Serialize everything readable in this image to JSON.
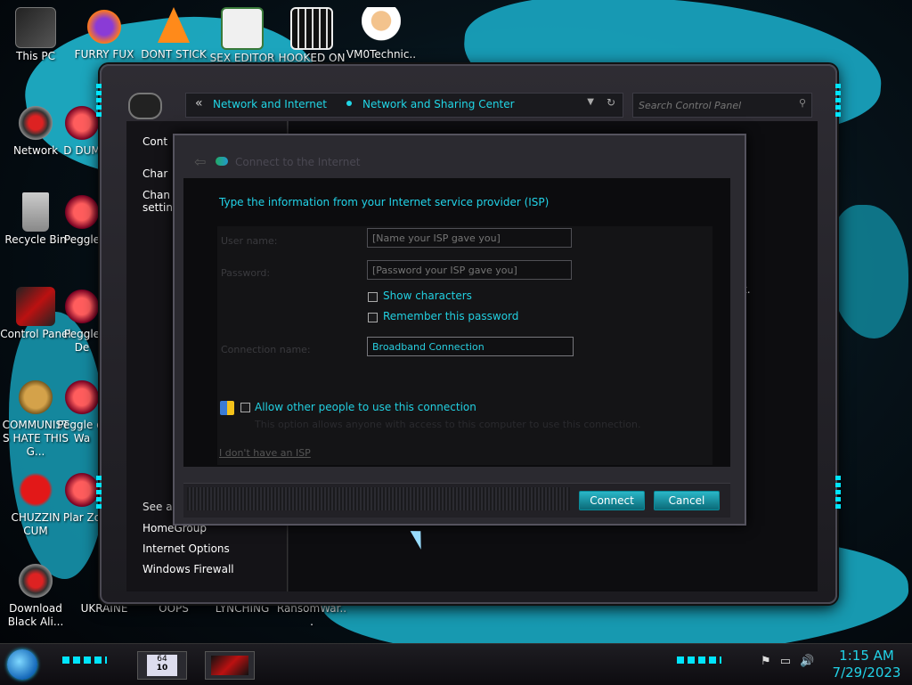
{
  "desktop": {
    "icons_top": [
      {
        "label": "This PC",
        "icon": "this-pc-icon"
      },
      {
        "label": "FURRY FUX",
        "icon": "firefox-icon"
      },
      {
        "label": "DONT STICK",
        "icon": "vlc-cone-icon"
      },
      {
        "label": "SEX EDITOR",
        "icon": "hex-editor-icon"
      },
      {
        "label": "HOOKED ON",
        "icon": "maze-icon"
      },
      {
        "label": "VM0Technic...",
        "icon": "doctor-icon"
      }
    ],
    "icons_left": [
      {
        "label": "Network",
        "icon": "network-icon"
      },
      {
        "label": "Recycle Bin",
        "icon": "recycle-bin-icon"
      },
      {
        "label": "Control Panel",
        "icon": "control-panel-icon"
      },
      {
        "label": "COMMUNISTS HATE THIS G...",
        "icon": "money-bag-icon"
      },
      {
        "label": "CHUZZIN CUM",
        "icon": "chuzzle-icon"
      },
      {
        "label": "Download Black Ali...",
        "icon": "network-icon"
      }
    ],
    "icons_col2": [
      {
        "label": "D DUM",
        "icon": "app-icon"
      },
      {
        "label": "Peggle",
        "icon": "peggle-icon"
      },
      {
        "label": "Peggle De",
        "icon": "peggle-icon"
      },
      {
        "label": "Peggle of Wa",
        "icon": "peggle-icon"
      },
      {
        "label": "Plar Zo",
        "icon": "flower-icon"
      }
    ],
    "icons_bottom": [
      "UKRAINE",
      "OOPS",
      "LYNCHING",
      "RansomWar..."
    ]
  },
  "explorer": {
    "breadcrumb": {
      "back": "«",
      "items": [
        "Network and Internet",
        "Network and Sharing Center"
      ]
    },
    "search": {
      "placeholder": "Search Control Panel"
    },
    "left_pane": {
      "top_items": [
        "Cont",
        "Char",
        "Chan settin"
      ],
      "see_also": "See a",
      "links": [
        "HomeGroup",
        "Internet Options",
        "Windows Firewall"
      ]
    },
    "side_text": "t."
  },
  "dialog": {
    "title": "Connect to the Internet",
    "heading": "Type the information from your Internet service provider (ISP)",
    "fields": {
      "username_label": "User name:",
      "username_placeholder": "[Name your ISP gave you]",
      "password_label": "Password:",
      "password_placeholder": "[Password your ISP gave you]",
      "show_characters": "Show characters",
      "remember_password": "Remember this password",
      "connection_label": "Connection name:",
      "connection_value": "Broadband Connection"
    },
    "allow_others": "Allow other people to use this connection",
    "allow_note": "This option allows anyone with access to this computer to use this connection.",
    "no_isp_link": "I don't have an ISP",
    "buttons": {
      "connect": "Connect",
      "cancel": "Cancel"
    }
  },
  "taskbar": {
    "badge_top": "64",
    "badge_num": "10",
    "time": "1:15 AM",
    "date": "7/29/2023"
  },
  "colors": {
    "accent": "#22d3e8",
    "button": "#1a9fb0"
  }
}
